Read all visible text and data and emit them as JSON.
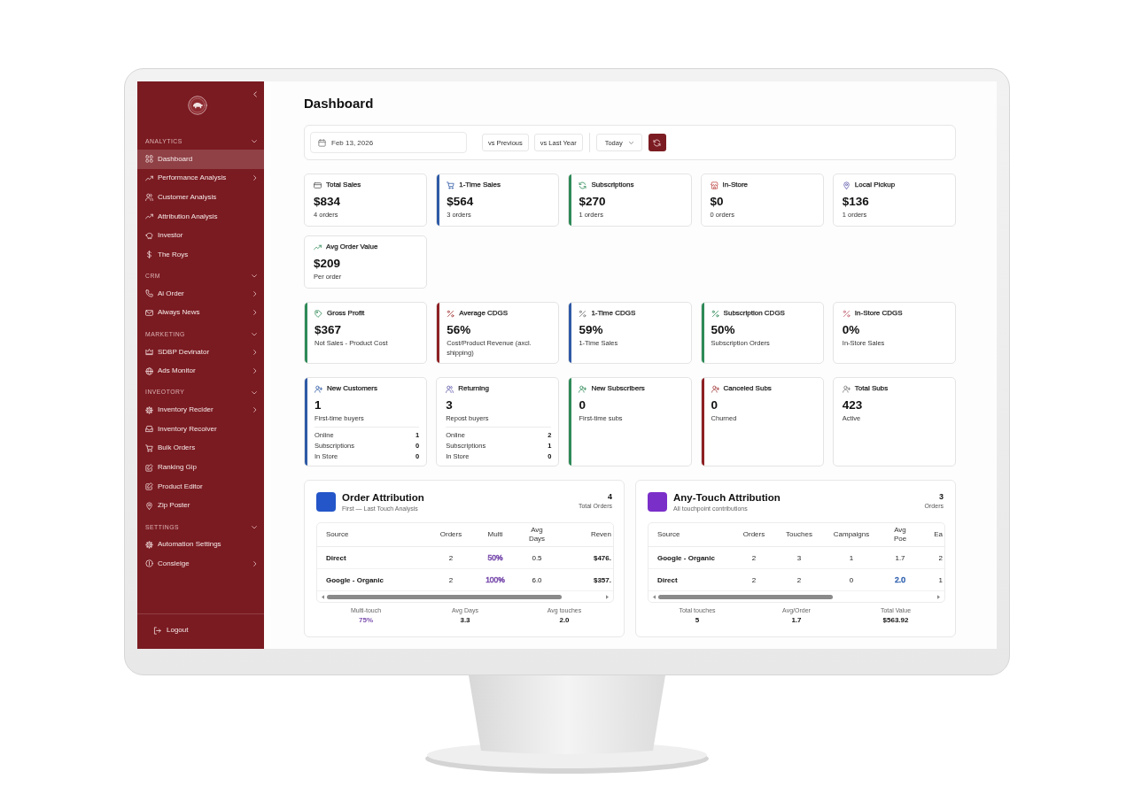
{
  "sidebar": {
    "sections": [
      {
        "title": "ANALYTICS",
        "expanded": true,
        "items": [
          {
            "label": "Dashboard",
            "selected": true,
            "submenu": false
          },
          {
            "label": "Performance Analysis",
            "selected": false,
            "submenu": true
          },
          {
            "label": "Customer Analysis",
            "selected": false,
            "submenu": false
          },
          {
            "label": "Attribution Analysis",
            "selected": false,
            "submenu": false
          },
          {
            "label": "Investor",
            "selected": false,
            "submenu": false
          },
          {
            "label": "The Roys",
            "selected": false,
            "submenu": false
          }
        ]
      },
      {
        "title": "CRM",
        "expanded": true,
        "items": [
          {
            "label": "Ai Order",
            "selected": false,
            "submenu": true
          },
          {
            "label": "Always News",
            "selected": false,
            "submenu": true
          }
        ]
      },
      {
        "title": "MARKETING",
        "expanded": true,
        "items": [
          {
            "label": "SDBP Devinator",
            "selected": false,
            "submenu": true
          },
          {
            "label": "Ads Monitor",
            "selected": false,
            "submenu": true
          }
        ]
      },
      {
        "title": "INVEOTORY",
        "expanded": true,
        "items": [
          {
            "label": "Inventory Recider",
            "selected": false,
            "submenu": true
          },
          {
            "label": "Inventory Recoiver",
            "selected": false,
            "submenu": false
          },
          {
            "label": "Bulk Orders",
            "selected": false,
            "submenu": false
          },
          {
            "label": "Ranking Gip",
            "selected": false,
            "submenu": false
          },
          {
            "label": "Product Editor",
            "selected": false,
            "submenu": false
          },
          {
            "label": "Zip Poster",
            "selected": false,
            "submenu": false
          }
        ]
      },
      {
        "title": "SETTINGS",
        "expanded": true,
        "items": [
          {
            "label": "Automation Settings",
            "selected": false,
            "submenu": false
          },
          {
            "label": "Consleige",
            "selected": false,
            "submenu": true
          }
        ]
      }
    ],
    "logout": "Logout"
  },
  "page": {
    "title": "Dashboard"
  },
  "filters": {
    "date": "Feb 13, 2026",
    "compare": [
      "vs Previous",
      "vs Last Year"
    ],
    "period": "Today"
  },
  "sales_cards": [
    {
      "label": "Total Sales",
      "value": "$834",
      "note": "4 orders"
    },
    {
      "label": "1-Time Sales",
      "value": "$564",
      "note": "3 orders",
      "color": "#2f5aa6"
    },
    {
      "label": "Subscriptions",
      "value": "$270",
      "note": "1 orders",
      "color": "#2e8a57"
    },
    {
      "label": "In-Store",
      "value": "$0",
      "note": "0 orders"
    },
    {
      "label": "Local Pickup",
      "value": "$136",
      "note": "1 orders"
    },
    {
      "label": "Avg Order Value",
      "value": "$209",
      "note": "Per order"
    }
  ],
  "cost_cards": [
    {
      "label": "Gross Profit",
      "value": "$367",
      "note": "Not Sales - Product Cost",
      "color": "#2e8a57"
    },
    {
      "label": "Average CDGS",
      "value": "56%",
      "note": "Cost/Product Revenue (axcl. shipping)",
      "color": "#8e2024"
    },
    {
      "label": "1-Time CDGS",
      "value": "59%",
      "note": "1-Time Sales",
      "color": "#2f5aa6"
    },
    {
      "label": "Subscription CDGS",
      "value": "50%",
      "note": "Subscription Orders",
      "color": "#2e8a57"
    },
    {
      "label": "In-Store CDGS",
      "value": "0%",
      "note": "In-Store Sales"
    }
  ],
  "customer_cards": [
    {
      "label": "New Customers",
      "value": "1",
      "note": "First-time buyers",
      "color": "#2f5aa6",
      "breakdown": [
        {
          "label": "Online",
          "value": "1"
        },
        {
          "label": "Subscriptions",
          "value": "0"
        },
        {
          "label": "In Store",
          "value": "0"
        }
      ]
    },
    {
      "label": "Returning",
      "value": "3",
      "note": "Repost buyers",
      "breakdown": [
        {
          "label": "Online",
          "value": "2"
        },
        {
          "label": "Subscriptions",
          "value": "1"
        },
        {
          "label": "In Store",
          "value": "0"
        }
      ]
    },
    {
      "label": "New Subscribers",
      "value": "0",
      "note": "First-time subs",
      "color": "#2e8a57"
    },
    {
      "label": "Canceled Subs",
      "value": "0",
      "note": "Churned",
      "color": "#8e2024"
    },
    {
      "label": "Total Subs",
      "value": "423",
      "note": "Active"
    }
  ],
  "attribution": [
    {
      "title": "Order Attribution",
      "subtitle": "First — Last Touch Analysis",
      "count": "4",
      "count_label": "Total Orders",
      "color": "#2456c9",
      "columns": [
        {
          "label": "Source",
          "bold": true
        },
        {
          "label": "Orders",
          "bold": false
        },
        {
          "label": "Multi",
          "bold": false
        },
        {
          "label": "Avg Days",
          "bold": false
        },
        {
          "label": "Reven",
          "bold": true
        }
      ],
      "rows": [
        [
          "Direct",
          "2",
          {
            "text": "50%",
            "color": "#7b4fae"
          },
          "0.5",
          "$476."
        ],
        [
          "Google - Organic",
          "2",
          {
            "text": "100%",
            "color": "#7b4fae"
          },
          "6.0",
          "$357."
        ]
      ],
      "stats": [
        {
          "label": "Multi-touch",
          "value": "75%",
          "color": "#7b4fae"
        },
        {
          "label": "Avg Days",
          "value": "3.3"
        },
        {
          "label": "Avg touches",
          "value": "2.0"
        }
      ]
    },
    {
      "title": "Any-Touch Attribution",
      "subtitle": "All touchpoint contributions",
      "count": "3",
      "count_label": "Orders",
      "color": "#7b2fc9",
      "columns": [
        {
          "label": "Source",
          "bold": true
        },
        {
          "label": "Orders",
          "bold": false
        },
        {
          "label": "Touches",
          "bold": false
        },
        {
          "label": "Campaigns",
          "bold": false
        },
        {
          "label": "Avg Poe",
          "bold": false
        },
        {
          "label": "Ea",
          "bold": false
        }
      ],
      "rows": [
        [
          "Google - Organic",
          "2",
          "3",
          "1",
          "1.7",
          "2"
        ],
        [
          "Direct",
          "2",
          "2",
          "0",
          {
            "text": "2.0",
            "color": "#3464b0"
          },
          "1"
        ]
      ],
      "stats": [
        {
          "label": "Total touches",
          "value": "5"
        },
        {
          "label": "Avg/Order",
          "value": "1.7"
        },
        {
          "label": "Total Value",
          "value": "$563.92"
        }
      ]
    }
  ]
}
